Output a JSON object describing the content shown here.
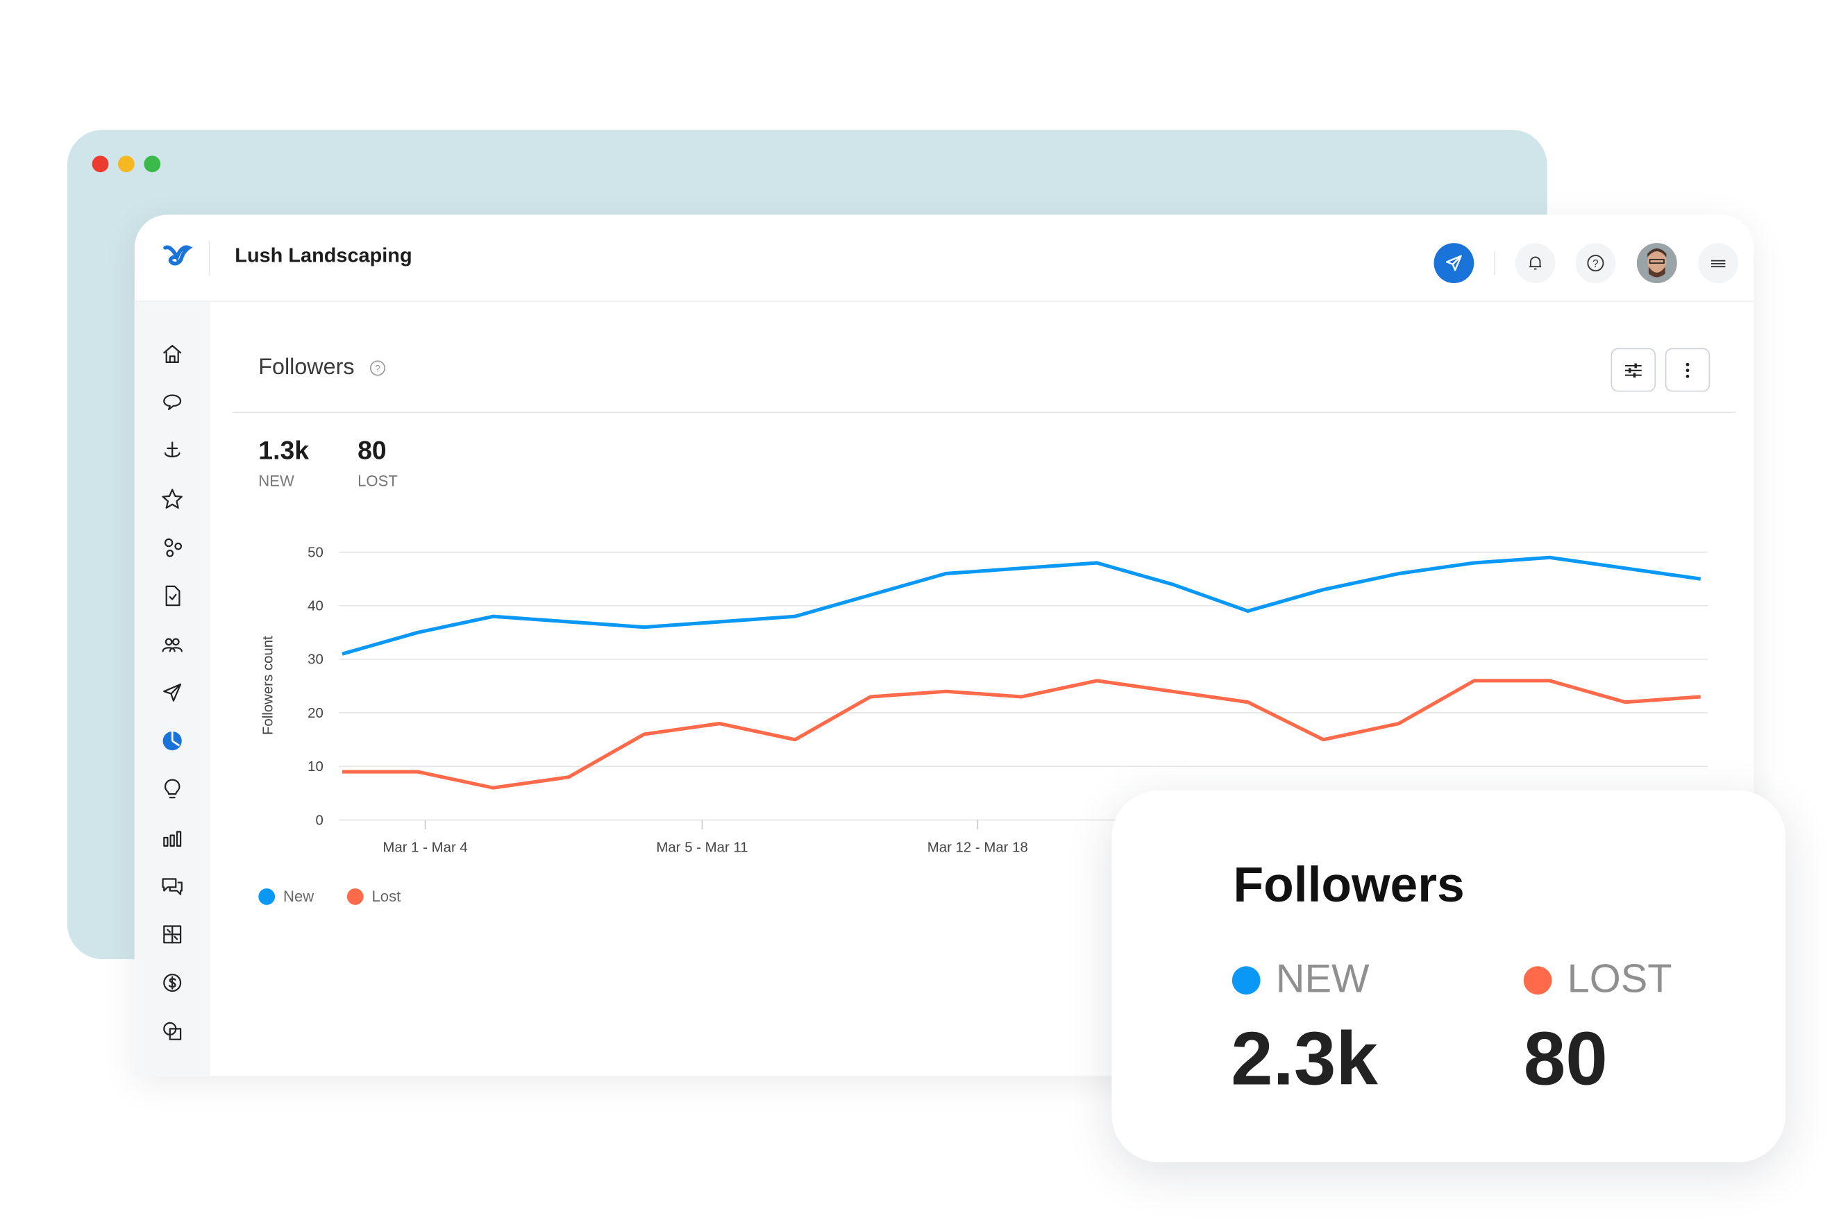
{
  "app": {
    "title": "Lush Landscaping"
  },
  "header": {
    "icons": [
      "send-icon",
      "bell-icon",
      "help-icon",
      "avatar",
      "menu-icon"
    ]
  },
  "sidebar": {
    "icons": [
      "home-icon",
      "chat-bubble-icon",
      "anchor-icon",
      "star-icon",
      "nodes-icon",
      "document-icon",
      "users-icon",
      "send-icon",
      "pie-chart-icon",
      "lightbulb-icon",
      "bar-chart-icon",
      "conversation-icon",
      "grid-icon",
      "dollar-icon",
      "shapes-icon"
    ],
    "active_index": 8
  },
  "panel": {
    "title": "Followers",
    "new_value": "1.3k",
    "new_label": "NEW",
    "lost_value": "80",
    "lost_label": "LOST"
  },
  "colors": {
    "new": "#0a98f7",
    "lost": "#ff6b4a",
    "accent": "#1a73d9",
    "window_back": "#d0e5ea"
  },
  "chart_data": {
    "type": "line",
    "ylabel": "Followers count",
    "ylim": [
      0,
      50
    ],
    "yticks": [
      0,
      10,
      20,
      30,
      40,
      50
    ],
    "grid": true,
    "xtick_labels": [
      "Mar 1 - Mar 4",
      "Mar 5 - Mar 11",
      "Mar 12 - Mar 18"
    ],
    "legend": "bottom-left",
    "series": [
      {
        "name": "New",
        "color": "#0a98f7",
        "values": [
          31,
          35,
          38,
          37,
          36,
          37,
          38,
          42,
          46,
          47,
          48,
          44,
          39,
          43,
          46,
          48,
          49,
          47,
          45
        ]
      },
      {
        "name": "Lost",
        "color": "#ff6b4a",
        "values": [
          9,
          9,
          6,
          8,
          16,
          18,
          15,
          23,
          24,
          23,
          26,
          24,
          22,
          15,
          18,
          26,
          26,
          22,
          23
        ]
      }
    ]
  },
  "card": {
    "title": "Followers",
    "new_label": "NEW",
    "new_value": "2.3k",
    "lost_label": "LOST",
    "lost_value": "80"
  }
}
